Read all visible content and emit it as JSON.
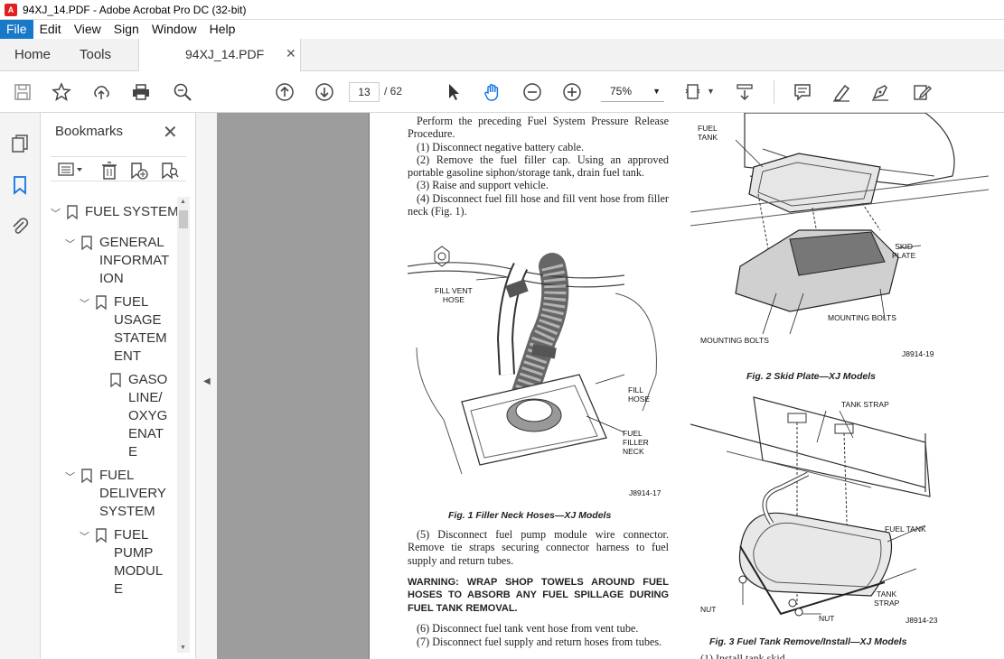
{
  "window": {
    "title": "94XJ_14.PDF - Adobe Acrobat Pro DC (32-bit)"
  },
  "menu": [
    "File",
    "Edit",
    "View",
    "Sign",
    "Window",
    "Help"
  ],
  "tabs": {
    "home": "Home",
    "tools": "Tools",
    "document": "94XJ_14.PDF"
  },
  "toolbar": {
    "current_page": "13",
    "page_total": "/ 62",
    "zoom": "75%"
  },
  "bookmarks": {
    "title": "Bookmarks",
    "items": [
      {
        "label": "FUEL SYSTEM"
      },
      {
        "label": "GENERAL\nINFORMAT\nION"
      },
      {
        "label": "FUEL\nUSAGE\nSTATEM\nENT"
      },
      {
        "label": "GASO\nLINE/\nOXYG\nENAT\nE"
      },
      {
        "label": "FUEL\nDELIVERY\nSYSTEM"
      },
      {
        "label": "FUEL\nPUMP\nMODUL\nE"
      }
    ]
  },
  "document": {
    "para_intro": "Perform the preceding Fuel System Pressure Release Procedure.",
    "steps_a": [
      "(1) Disconnect negative battery cable.",
      "(2) Remove the fuel filler cap. Using an approved portable gasoline siphon/storage tank, drain fuel tank.",
      "(3) Raise and support vehicle.",
      "(4) Disconnect fuel fill hose and fill vent hose from filler neck (Fig. 1)."
    ],
    "step5": "(5) Disconnect fuel pump module wire connector. Remove tie straps securing connector harness to fuel supply and return tubes.",
    "warning": "WARNING: WRAP SHOP TOWELS AROUND FUEL HOSES TO ABSORB ANY FUEL SPILLAGE DURING FUEL TANK REMOVAL.",
    "step6": "(6) Disconnect fuel tank vent hose from vent tube.",
    "step7": "(7) Disconnect fuel supply and return hoses from tubes.",
    "fig1": {
      "caption": "Fig. 1 Filler Neck Hoses—XJ Models",
      "id": "J8914-17",
      "labels": {
        "vent": "FILL VENT\nHOSE",
        "fill": "FILL\nHOSE",
        "neck": "FUEL\nFILLER\nNECK"
      }
    },
    "fig2": {
      "caption": "Fig. 2 Skid Plate—XJ Models",
      "id": "J8914-19",
      "labels": {
        "tank": "FUEL\nTANK",
        "skid": "SKID\nPLATE",
        "bolts_r": "MOUNTING BOLTS",
        "bolts_l": "MOUNTING BOLTS"
      }
    },
    "fig3": {
      "caption": "Fig. 3 Fuel Tank Remove/Install—XJ Models",
      "id": "J8914-23",
      "labels": {
        "strap_top": "TANK STRAP",
        "tank": "FUEL TANK",
        "strap_r": "TANK\nSTRAP",
        "nut_l": "NUT",
        "nut_b": "NUT"
      }
    },
    "cut_text": "(1) Install tank skid"
  }
}
